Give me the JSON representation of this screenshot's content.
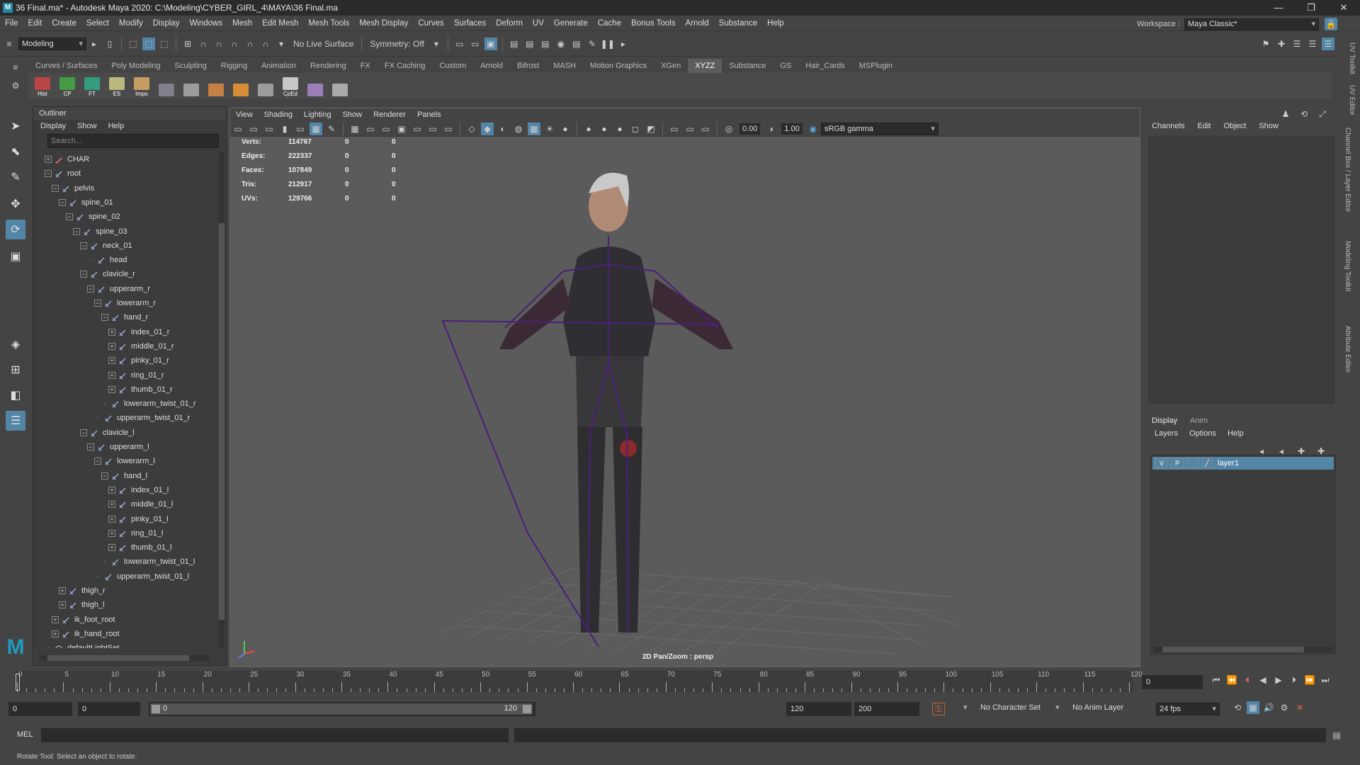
{
  "window": {
    "title": "36 Final.ma* - Autodesk Maya 2020: C:\\Modeling\\CYBER_GIRL_4\\MAYA\\36 Final.ma"
  },
  "menubar": [
    "File",
    "Edit",
    "Create",
    "Select",
    "Modify",
    "Display",
    "Windows",
    "Mesh",
    "Edit Mesh",
    "Mesh Tools",
    "Mesh Display",
    "Curves",
    "Surfaces",
    "Deform",
    "UV",
    "Generate",
    "Cache",
    "Bonus Tools",
    "Arnold",
    "Substance",
    "Help"
  ],
  "workspace": {
    "label": "Workspace :",
    "value": "Maya Classic*"
  },
  "statusline": {
    "mode": "Modeling",
    "live_surface": "No Live Surface",
    "symmetry": "Symmetry: Off"
  },
  "shelf_tabs": [
    "Curves / Surfaces",
    "Poly Modeling",
    "Sculpting",
    "Rigging",
    "Animation",
    "Rendering",
    "FX",
    "FX Caching",
    "Custom",
    "Arnold",
    "Bifrost",
    "MASH",
    "Motion Graphics",
    "XGen",
    "XYZZ",
    "Substance",
    "GS",
    "Hair_Cards",
    "MSPlugin"
  ],
  "shelf_active": "XYZZ",
  "shelf_buttons": [
    "Hist",
    "CP",
    "FT",
    "ES",
    "Impo",
    "",
    "",
    "",
    "",
    "",
    "CpEd",
    "",
    ""
  ],
  "outliner": {
    "title": "Outliner",
    "menu": [
      "Display",
      "Show",
      "Help"
    ],
    "search_placeholder": "Search...",
    "items": [
      {
        "label": "CHAR",
        "depth": 0,
        "exp": "+",
        "icon": "group"
      },
      {
        "label": "root",
        "depth": 0,
        "exp": "-",
        "icon": "joint"
      },
      {
        "label": "pelvis",
        "depth": 1,
        "exp": "-",
        "icon": "joint"
      },
      {
        "label": "spine_01",
        "depth": 2,
        "exp": "-",
        "icon": "joint"
      },
      {
        "label": "spine_02",
        "depth": 3,
        "exp": "-",
        "icon": "joint"
      },
      {
        "label": "spine_03",
        "depth": 4,
        "exp": "-",
        "icon": "joint"
      },
      {
        "label": "neck_01",
        "depth": 5,
        "exp": "-",
        "icon": "joint"
      },
      {
        "label": "head",
        "depth": 6,
        "exp": "",
        "icon": "joint"
      },
      {
        "label": "clavicle_r",
        "depth": 5,
        "exp": "-",
        "icon": "joint"
      },
      {
        "label": "upperarm_r",
        "depth": 6,
        "exp": "-",
        "icon": "joint"
      },
      {
        "label": "lowerarm_r",
        "depth": 7,
        "exp": "-",
        "icon": "joint"
      },
      {
        "label": "hand_r",
        "depth": 8,
        "exp": "-",
        "icon": "joint"
      },
      {
        "label": "index_01_r",
        "depth": 9,
        "exp": "+",
        "icon": "joint"
      },
      {
        "label": "middle_01_r",
        "depth": 9,
        "exp": "+",
        "icon": "joint"
      },
      {
        "label": "pinky_01_r",
        "depth": 9,
        "exp": "+",
        "icon": "joint"
      },
      {
        "label": "ring_01_r",
        "depth": 9,
        "exp": "+",
        "icon": "joint"
      },
      {
        "label": "thumb_01_r",
        "depth": 9,
        "exp": "+",
        "icon": "joint"
      },
      {
        "label": "lowerarm_twist_01_r",
        "depth": 8,
        "exp": "",
        "icon": "joint"
      },
      {
        "label": "upperarm_twist_01_r",
        "depth": 7,
        "exp": "",
        "icon": "joint"
      },
      {
        "label": "clavicle_l",
        "depth": 5,
        "exp": "-",
        "icon": "joint"
      },
      {
        "label": "upperarm_l",
        "depth": 6,
        "exp": "-",
        "icon": "joint"
      },
      {
        "label": "lowerarm_l",
        "depth": 7,
        "exp": "-",
        "icon": "joint"
      },
      {
        "label": "hand_l",
        "depth": 8,
        "exp": "-",
        "icon": "joint"
      },
      {
        "label": "index_01_l",
        "depth": 9,
        "exp": "+",
        "icon": "joint"
      },
      {
        "label": "middle_01_l",
        "depth": 9,
        "exp": "+",
        "icon": "joint"
      },
      {
        "label": "pinky_01_l",
        "depth": 9,
        "exp": "+",
        "icon": "joint"
      },
      {
        "label": "ring_01_l",
        "depth": 9,
        "exp": "+",
        "icon": "joint"
      },
      {
        "label": "thumb_01_l",
        "depth": 9,
        "exp": "+",
        "icon": "joint"
      },
      {
        "label": "lowerarm_twist_01_l",
        "depth": 8,
        "exp": "",
        "icon": "joint"
      },
      {
        "label": "upperarm_twist_01_l",
        "depth": 7,
        "exp": "",
        "icon": "joint"
      },
      {
        "label": "thigh_r",
        "depth": 2,
        "exp": "+",
        "icon": "joint"
      },
      {
        "label": "thigh_l",
        "depth": 2,
        "exp": "+",
        "icon": "joint"
      },
      {
        "label": "ik_foot_root",
        "depth": 1,
        "exp": "+",
        "icon": "joint"
      },
      {
        "label": "ik_hand_root",
        "depth": 1,
        "exp": "+",
        "icon": "joint"
      },
      {
        "label": "defaultLightSet",
        "depth": 0,
        "exp": "",
        "icon": "set"
      }
    ]
  },
  "viewport": {
    "menu": [
      "View",
      "Shading",
      "Lighting",
      "Show",
      "Renderer",
      "Panels"
    ],
    "exposure": "0.00",
    "gamma": "1.00",
    "colorspace": "sRGB gamma",
    "camera_label": "2D Pan/Zoom : persp",
    "hud": [
      {
        "label": "Verts:",
        "v1": "114767",
        "v2": "0",
        "v3": "0"
      },
      {
        "label": "Edges:",
        "v1": "222337",
        "v2": "0",
        "v3": "0"
      },
      {
        "label": "Faces:",
        "v1": "107849",
        "v2": "0",
        "v3": "0"
      },
      {
        "label": "Tris:",
        "v1": "212917",
        "v2": "0",
        "v3": "0"
      },
      {
        "label": "UVs:",
        "v1": "129766",
        "v2": "0",
        "v3": "0"
      }
    ]
  },
  "channel_box": {
    "menu": [
      "Channels",
      "Edit",
      "Object",
      "Show"
    ]
  },
  "layer_editor": {
    "tabs": [
      "Display",
      "Anim"
    ],
    "menu": [
      "Layers",
      "Options",
      "Help"
    ],
    "layer": {
      "v": "V",
      "p": "P",
      "name": "layer1"
    }
  },
  "side_tabs": [
    "UV Toolkit",
    "UV Editor",
    "Channel Box / Layer Editor",
    "Modeling Toolkit",
    "Attribute Editor"
  ],
  "timeslider": {
    "ticks": [
      "0",
      "5",
      "10",
      "15",
      "20",
      "25",
      "30",
      "35",
      "40",
      "45",
      "50",
      "55",
      "60",
      "65",
      "70",
      "75",
      "80",
      "85",
      "90",
      "95",
      "100",
      "105",
      "110",
      "115",
      "120"
    ],
    "current_frame": "0"
  },
  "range": {
    "start": "0",
    "anim_start": "0",
    "range_start": "0",
    "range_end": "120",
    "anim_end": "120",
    "end": "200",
    "character_set": "No Character Set",
    "anim_layer": "No Anim Layer",
    "fps": "24 fps"
  },
  "mel": {
    "label": "MEL"
  },
  "helpline": "Rotate Tool: Select an object to rotate.",
  "colors": {
    "highlight": "#5285a6",
    "joint": "#5a2a8a",
    "panel": "#444444"
  }
}
